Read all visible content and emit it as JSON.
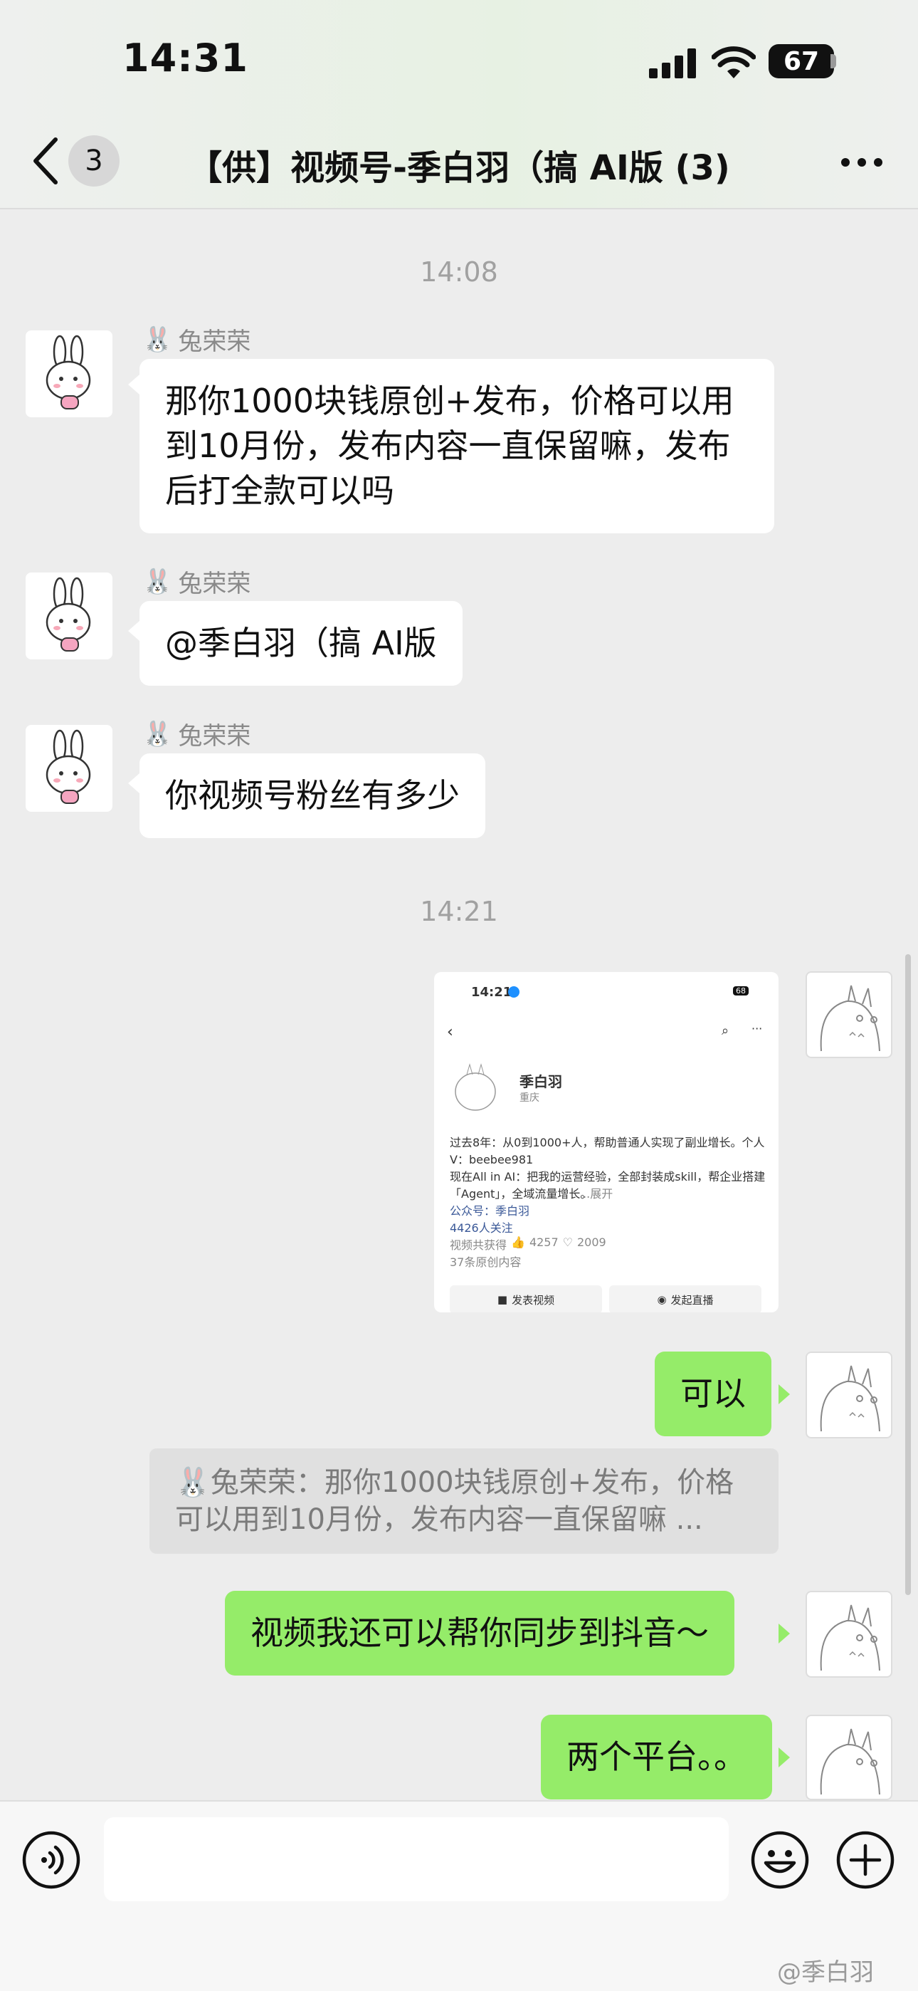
{
  "status": {
    "time": "14:31",
    "battery": "67"
  },
  "nav": {
    "badge": "3",
    "title": "【供】视频号-季白羽（搞 AI版 (3)"
  },
  "chat": {
    "timestamps": [
      "14:08",
      "14:21"
    ],
    "messages": [
      {
        "sender": "兔荣荣",
        "text": "那你1000块钱原创+发布，价格可以用到10月份，发布内容一直保留嘛，发布后打全款可以吗"
      },
      {
        "sender": "兔荣荣",
        "text": "@季白羽（搞 AI版"
      },
      {
        "sender": "兔荣荣",
        "text": "你视频号粉丝有多少"
      }
    ],
    "my_messages": [
      "可以",
      "视频我还可以帮你同步到抖音～",
      "两个平台。。"
    ],
    "quote": {
      "sender": "兔荣荣",
      "text": "那你1000块钱原创+发布，价格可以用到10月份，发布内容一直保留嘛 ..."
    }
  },
  "shared_screenshot": {
    "time": "14:21",
    "battery": "68",
    "name": "季白羽",
    "location": "重庆",
    "bio_1": "过去8年：从0到1000+人，帮助普通人实现了副业增长。个人",
    "bio_2": "V：beebee981",
    "bio_3": "现在All in AI：把我的运营经验，全部封装成skill，帮企业搭建",
    "bio_4": "「Agent」，全域流量增长。",
    "expand": "...展开",
    "account": "公众号：季白羽",
    "followers": "4426人关注",
    "stats": "视频共获得",
    "likes": "4257",
    "hearts": "2009",
    "original": "37条原创内容",
    "btn_post": "发表视频",
    "btn_live": "发起直播"
  },
  "watermark": "@季白羽"
}
